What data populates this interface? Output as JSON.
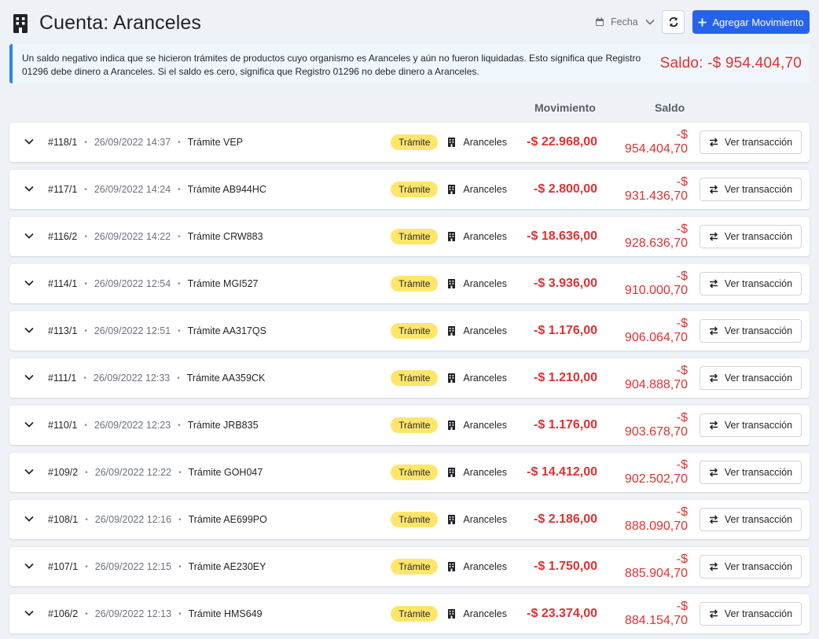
{
  "header": {
    "title": "Cuenta: Aranceles",
    "filter_label": "Fecha",
    "add_button_label": "Agregar Movimiento"
  },
  "info": {
    "text": "Un saldo negativo indica que se hicieron trámites de productos cuyo organismo es Aranceles y aún no fueron liquidadas. Esto significa que Registro 01296 debe dinero a Aranceles. Si el saldo es cero, significa que Registro 01296 no debe dinero a Aranceles.",
    "saldo": "Saldo: -$ 954.404,70"
  },
  "columns": {
    "movement": "Movimiento",
    "balance": "Saldo"
  },
  "colors": {
    "accent": "#2563eb",
    "negative": "#e03131",
    "badge": "#ffe66b",
    "info_border": "#2f80ed",
    "background": "#eef1f5"
  },
  "rows": [
    {
      "id": "#118/1",
      "date": "26/09/2022 14:37",
      "desc": "Trámite VEP",
      "badge": "Trámite",
      "org": "Aranceles",
      "movement": "-$ 22.968,00",
      "balance": "-$ 954.404,70",
      "action": "Ver transacción"
    },
    {
      "id": "#117/1",
      "date": "26/09/2022 14:24",
      "desc": "Trámite AB944HC",
      "badge": "Trámite",
      "org": "Aranceles",
      "movement": "-$ 2.800,00",
      "balance": "-$ 931.436,70",
      "action": "Ver transacción"
    },
    {
      "id": "#116/2",
      "date": "26/09/2022 14:22",
      "desc": "Trámite CRW883",
      "badge": "Trámite",
      "org": "Aranceles",
      "movement": "-$ 18.636,00",
      "balance": "-$ 928.636,70",
      "action": "Ver transacción"
    },
    {
      "id": "#114/1",
      "date": "26/09/2022 12:54",
      "desc": "Trámite MGI527",
      "badge": "Trámite",
      "org": "Aranceles",
      "movement": "-$ 3.936,00",
      "balance": "-$ 910.000,70",
      "action": "Ver transacción"
    },
    {
      "id": "#113/1",
      "date": "26/09/2022 12:51",
      "desc": "Trámite AA317QS",
      "badge": "Trámite",
      "org": "Aranceles",
      "movement": "-$ 1.176,00",
      "balance": "-$ 906.064,70",
      "action": "Ver transacción"
    },
    {
      "id": "#111/1",
      "date": "26/09/2022 12:33",
      "desc": "Trámite AA359CK",
      "badge": "Trámite",
      "org": "Aranceles",
      "movement": "-$ 1.210,00",
      "balance": "-$ 904.888,70",
      "action": "Ver transacción"
    },
    {
      "id": "#110/1",
      "date": "26/09/2022 12:23",
      "desc": "Trámite JRB835",
      "badge": "Trámite",
      "org": "Aranceles",
      "movement": "-$ 1.176,00",
      "balance": "-$ 903.678,70",
      "action": "Ver transacción"
    },
    {
      "id": "#109/2",
      "date": "26/09/2022 12:22",
      "desc": "Trámite GOH047",
      "badge": "Trámite",
      "org": "Aranceles",
      "movement": "-$ 14.412,00",
      "balance": "-$ 902.502,70",
      "action": "Ver transacción"
    },
    {
      "id": "#108/1",
      "date": "26/09/2022 12:16",
      "desc": "Trámite AE699PO",
      "badge": "Trámite",
      "org": "Aranceles",
      "movement": "-$ 2.186,00",
      "balance": "-$ 888.090,70",
      "action": "Ver transacción"
    },
    {
      "id": "#107/1",
      "date": "26/09/2022 12:15",
      "desc": "Trámite AE230EY",
      "badge": "Trámite",
      "org": "Aranceles",
      "movement": "-$ 1.750,00",
      "balance": "-$ 885.904,70",
      "action": "Ver transacción"
    },
    {
      "id": "#106/2",
      "date": "26/09/2022 12:13",
      "desc": "Trámite HMS649",
      "badge": "Trámite",
      "org": "Aranceles",
      "movement": "-$ 23.374,00",
      "balance": "-$ 884.154,70",
      "action": "Ver transacción"
    }
  ]
}
